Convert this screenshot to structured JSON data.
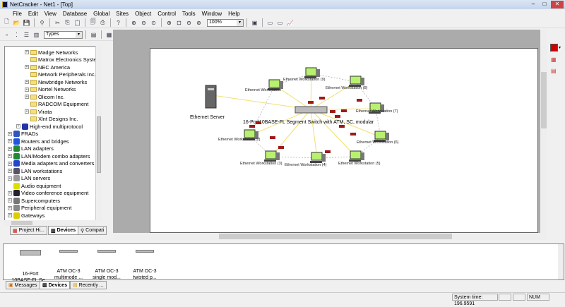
{
  "window": {
    "title": "NetCracker - Net1 - [Top]"
  },
  "menu": [
    "File",
    "Edit",
    "View",
    "Database",
    "Global",
    "Sites",
    "Object",
    "Control",
    "Tools",
    "Window",
    "Help"
  ],
  "toolbar": {
    "zoom": "100%",
    "types": "Types"
  },
  "tree": [
    {
      "label": "Madge Networks",
      "level": 2,
      "expand": true,
      "icon": "folder-icon"
    },
    {
      "label": "Matrox Electronics System",
      "level": 2,
      "expand": false,
      "icon": "folder-icon"
    },
    {
      "label": "NEC America",
      "level": 2,
      "expand": true,
      "icon": "folder-icon"
    },
    {
      "label": "Network Peripherals Inc.",
      "level": 2,
      "expand": false,
      "icon": "folder-icon"
    },
    {
      "label": "Newbridge Networks",
      "level": 2,
      "expand": true,
      "icon": "folder-icon"
    },
    {
      "label": "Nortel Networks",
      "level": 2,
      "expand": true,
      "icon": "folder-icon"
    },
    {
      "label": "Olicom Inc.",
      "level": 2,
      "expand": true,
      "icon": "folder-icon"
    },
    {
      "label": "RADCOM Equipment",
      "level": 2,
      "expand": false,
      "icon": "folder-icon"
    },
    {
      "label": "Virata",
      "level": 2,
      "expand": true,
      "icon": "folder-icon"
    },
    {
      "label": "Xlnt Designs Inc.",
      "level": 2,
      "expand": false,
      "icon": "folder-icon"
    },
    {
      "label": "High-end multiprotocol",
      "level": 1,
      "expand": true,
      "icon": "multiprotocol-icon"
    },
    {
      "label": "FRADs",
      "level": 0,
      "expand": true,
      "icon": "frad-icon"
    },
    {
      "label": "Routers and bridges",
      "level": 0,
      "expand": true,
      "icon": "router-icon"
    },
    {
      "label": "LAN adapters",
      "level": 0,
      "expand": true,
      "icon": "adapter-icon"
    },
    {
      "label": "LAN/Modem combo adapters",
      "level": 0,
      "expand": true,
      "icon": "adapter-icon"
    },
    {
      "label": "Media adapters and converters ar",
      "level": 0,
      "expand": true,
      "icon": "media-adapter-icon"
    },
    {
      "label": "LAN workstations",
      "level": 0,
      "expand": true,
      "icon": "workstation-icon"
    },
    {
      "label": "LAN servers",
      "level": 0,
      "expand": true,
      "icon": "server-icon"
    },
    {
      "label": "Audio equipment",
      "level": 0,
      "expand": false,
      "icon": "audio-icon"
    },
    {
      "label": "Video conference equipment",
      "level": 0,
      "expand": true,
      "icon": "video-icon"
    },
    {
      "label": "Supercomputers",
      "level": 0,
      "expand": true,
      "icon": "supercomputer-icon"
    },
    {
      "label": "Peripheral equipment",
      "level": 0,
      "expand": true,
      "icon": "peripheral-icon"
    },
    {
      "label": "Gateways",
      "level": 0,
      "expand": true,
      "icon": "gateway-icon"
    }
  ],
  "left_tabs": [
    "Project Hi...",
    "Devices",
    "Compati"
  ],
  "diagram": {
    "server": "Ethernet Server",
    "switch": "16-Port10BASE-FL Segment Switch with ATM, SC, modular",
    "workstations": [
      "Ethernet Workstation",
      "Ethernet Workstation (9)",
      "Ethernet Workstation (8)",
      "Ethernet Workstation (7)",
      "Ethernet Workstation (6)",
      "Ethernet Workstation (5)",
      "Ethernet Workstation (4)",
      "Ethernet Workstation (3)",
      "Ethernet Workstation (2)"
    ]
  },
  "devices": [
    {
      "l1": "16-Port",
      "l2": "10BASE-FL Se..."
    },
    {
      "l1": "ATM OC-3",
      "l2": "multimode ..."
    },
    {
      "l1": "ATM OC-3",
      "l2": "single mod..."
    },
    {
      "l1": "ATM OC-3",
      "l2": "twisted p..."
    }
  ],
  "bottom_tabs": [
    "Messages",
    "Devices",
    "Recently ..."
  ],
  "status": {
    "time": "System time: 196.9591",
    "num": "NUM"
  },
  "colors": {
    "link": "#f0e070",
    "traffic": "#a01818",
    "screen": "#b8f070"
  }
}
